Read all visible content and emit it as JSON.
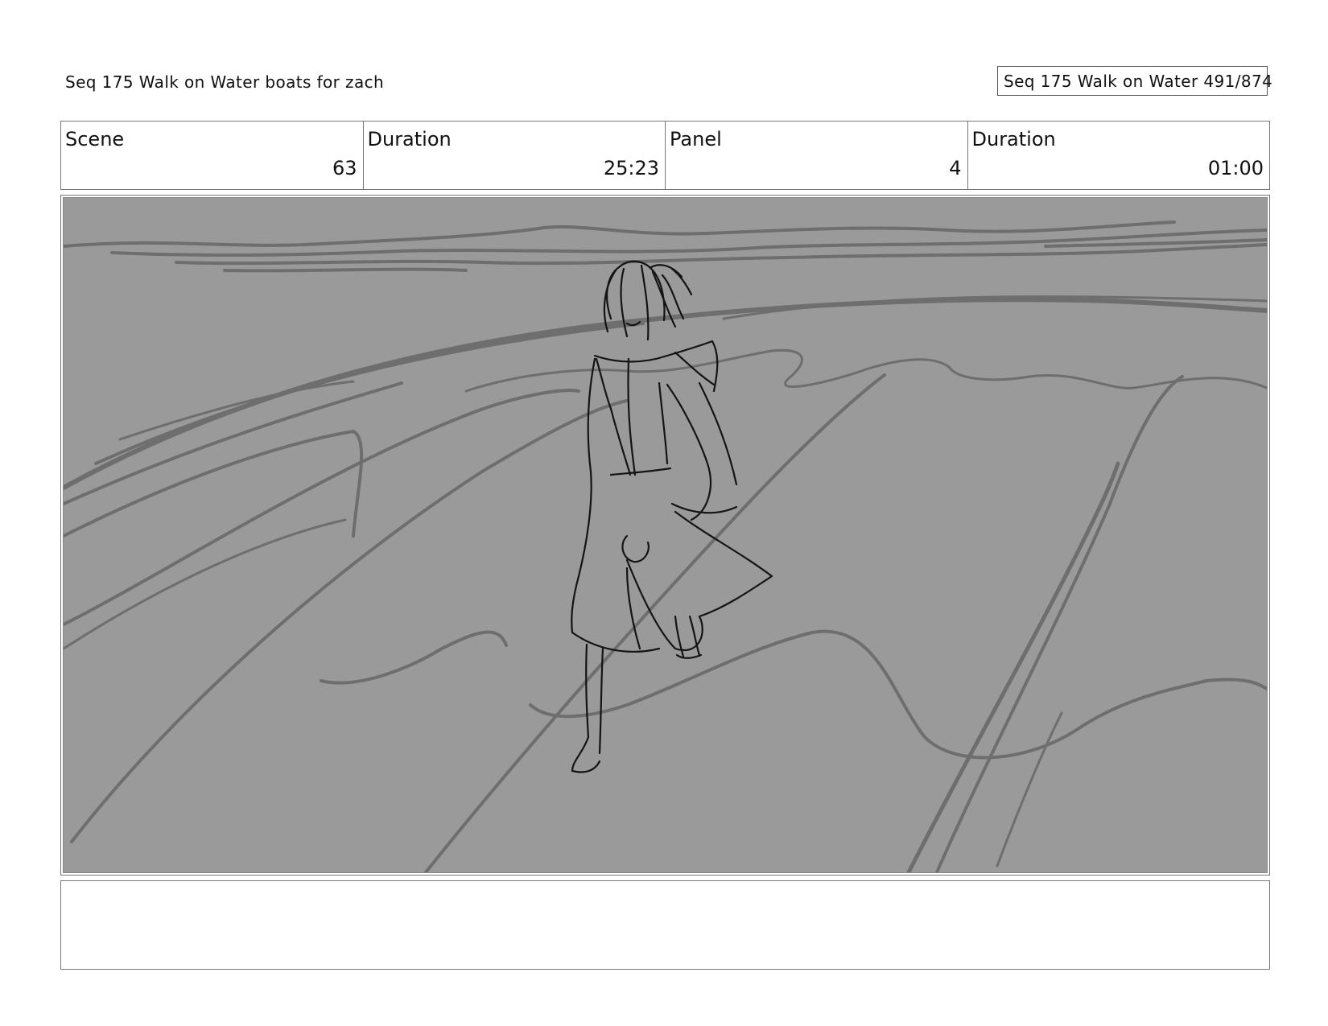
{
  "header": {
    "title": "Seq 175 Walk on Water  boats for zach",
    "page_indicator": "Seq 175 Walk on Water 491/874"
  },
  "info": {
    "scene_label": "Scene",
    "scene_value": "63",
    "duration_label": "Duration",
    "duration_value": "25:23",
    "panel_label": "Panel",
    "panel_value": "4",
    "panel_duration_label": "Duration",
    "panel_duration_value": "01:00"
  },
  "notes": {
    "text": ""
  }
}
